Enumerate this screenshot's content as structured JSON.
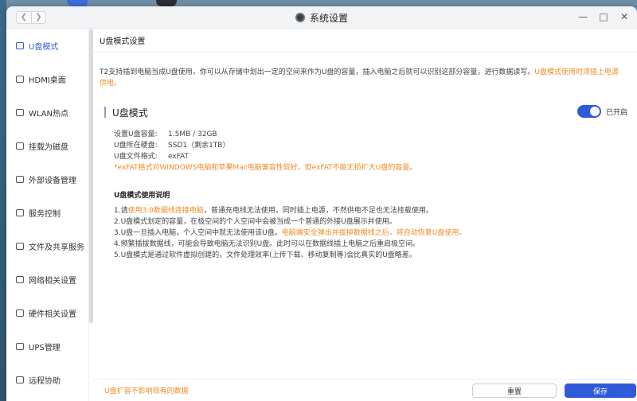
{
  "window": {
    "title": "系统设置"
  },
  "sidebar": {
    "items": [
      {
        "label": "U盘模式",
        "active": true
      },
      {
        "label": "HDMI桌面"
      },
      {
        "label": "WLAN热点"
      },
      {
        "label": "挂载为磁盘"
      },
      {
        "label": "外部设备管理"
      },
      {
        "label": "服务控制"
      },
      {
        "label": "文件及共享服务"
      },
      {
        "label": "网络相关设置"
      },
      {
        "label": "硬件相关设置"
      },
      {
        "label": "UPS管理"
      },
      {
        "label": "远程协助"
      }
    ]
  },
  "main": {
    "section_title": "U盘模式设置",
    "intro_text": "T2支持插到电脑当成U盘使用，你可以从存储中划出一定的空间来作为U盘的容量，插入电脑之后就可以识别这部分容量，进行数据读写。",
    "intro_warning": "U盘模式使用时须插上电源供电。",
    "mode_title": "U盘模式",
    "toggle_state": "已开启",
    "info": {
      "capacity_label": "设置U盘容量:",
      "capacity_value": "1.5MB / 32GB",
      "disk_label": "U盘所在硬盘:",
      "disk_value": "SSD1（剩余1TB）",
      "format_label": "U盘文件格式:",
      "format_value": "exFAT",
      "format_note": "*exFAT格式对WINDOWS电脑和苹果Mac电脑兼容性较好，但exFAT不能无损扩大U盘的容量。"
    },
    "explain_title": "U盘模式使用说明",
    "explain": {
      "l1_a": "1.请",
      "l1_orange": "使用3.0数据线连接电脑",
      "l1_b": "，普通充电线无法使用，同时插上电源，不然供电不足也无法挂载使用。",
      "l2": "2.U盘模式划定的容量，在极空间的个人空间中会被当成一个普通的外接U盘展示并使用。",
      "l3_a": "3.U盘一旦插入电脑，个人空间中就无法使用该U盘。",
      "l3_orange": "电脑端安全弹出并拔掉数据线之后，将自动恢复U盘使用。",
      "l4": "4.频繁插拔数据线，可能会导致电脑无法识别U盘。此时可以在数据线插上电脑之后重启极空间。",
      "l5": "5.U盘模式是通过软件虚拟创建的，文件处理效率(上传下载、移动复制等)会比真实的U盘略差。"
    }
  },
  "footer": {
    "note": "U盘扩容不影响现有的数据",
    "reset_label": "重置",
    "save_label": "保存"
  },
  "colors": {
    "accent": "#2f5bd8",
    "warning": "#f08a24"
  }
}
